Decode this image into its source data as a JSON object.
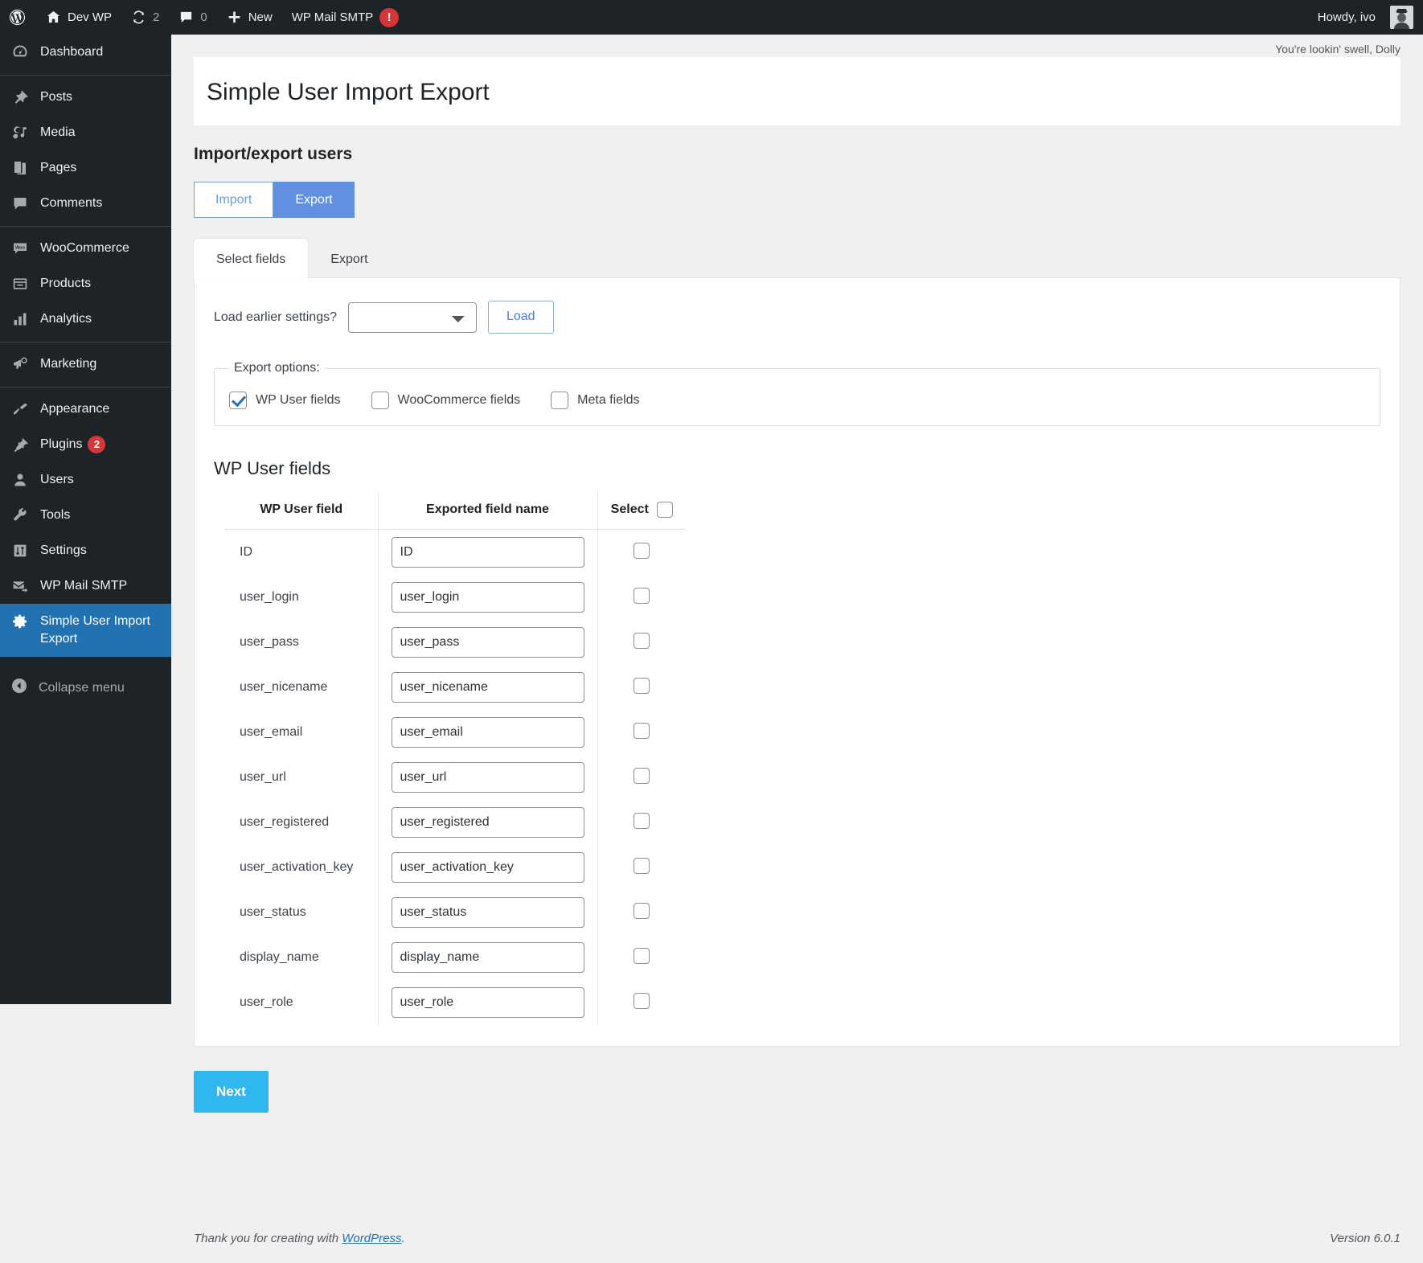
{
  "adminbar": {
    "wp_logo": "wordpress-logo-icon",
    "site_name": "Dev WP",
    "updates_count": "2",
    "comments_count": "0",
    "new_label": "New",
    "smtp_label": "WP Mail SMTP",
    "smtp_badge": "!",
    "howdy": "Howdy, ivo"
  },
  "sidebar": {
    "items": [
      {
        "label": "Dashboard",
        "icon": "dashboard-icon"
      },
      {
        "label": "Posts",
        "icon": "pin-icon"
      },
      {
        "label": "Media",
        "icon": "media-icon"
      },
      {
        "label": "Pages",
        "icon": "pages-icon"
      },
      {
        "label": "Comments",
        "icon": "comment-icon"
      },
      {
        "label": "WooCommerce",
        "icon": "woo-icon"
      },
      {
        "label": "Products",
        "icon": "product-icon"
      },
      {
        "label": "Analytics",
        "icon": "analytics-icon"
      },
      {
        "label": "Marketing",
        "icon": "megaphone-icon"
      },
      {
        "label": "Appearance",
        "icon": "paintbrush-icon"
      },
      {
        "label": "Plugins",
        "icon": "plug-icon",
        "count": "2"
      },
      {
        "label": "Users",
        "icon": "user-icon"
      },
      {
        "label": "Tools",
        "icon": "wrench-icon"
      },
      {
        "label": "Settings",
        "icon": "sliders-icon"
      },
      {
        "label": "WP Mail SMTP",
        "icon": "mail-arrow-icon"
      },
      {
        "label": "Simple User Import Export",
        "icon": "gear-icon",
        "current": true
      }
    ],
    "collapse_label": "Collapse menu"
  },
  "screen_meta": "You're lookin' swell, Dolly",
  "page": {
    "title": "Simple User Import Export",
    "section_title": "Import/export users"
  },
  "mode_tabs": {
    "import_label": "Import",
    "export_label": "Export",
    "active": "Export"
  },
  "inner_tabs": [
    {
      "label": "Select fields",
      "active": true
    },
    {
      "label": "Export",
      "active": false
    }
  ],
  "load_settings": {
    "label": "Load earlier settings?",
    "selected_value": "",
    "button_label": "Load"
  },
  "export_options": {
    "legend": "Export options:",
    "options": [
      {
        "label": "WP User fields",
        "checked": true
      },
      {
        "label": "WooCommerce fields",
        "checked": false
      },
      {
        "label": "Meta fields",
        "checked": false
      }
    ]
  },
  "fields_section": {
    "heading": "WP User fields",
    "columns": {
      "field": "WP User field",
      "exported": "Exported field name",
      "select": "Select"
    },
    "select_all_checked": false,
    "rows": [
      {
        "field": "ID",
        "exported": "ID",
        "selected": false
      },
      {
        "field": "user_login",
        "exported": "user_login",
        "selected": false
      },
      {
        "field": "user_pass",
        "exported": "user_pass",
        "selected": false
      },
      {
        "field": "user_nicename",
        "exported": "user_nicename",
        "selected": false
      },
      {
        "field": "user_email",
        "exported": "user_email",
        "selected": false
      },
      {
        "field": "user_url",
        "exported": "user_url",
        "selected": false
      },
      {
        "field": "user_registered",
        "exported": "user_registered",
        "selected": false
      },
      {
        "field": "user_activation_key",
        "exported": "user_activation_key",
        "selected": false
      },
      {
        "field": "user_status",
        "exported": "user_status",
        "selected": false
      },
      {
        "field": "display_name",
        "exported": "display_name",
        "selected": false
      },
      {
        "field": "user_role",
        "exported": "user_role",
        "selected": false
      }
    ]
  },
  "next_button": "Next",
  "footer": {
    "thanks_prefix": "Thank you for creating with ",
    "wordpress_link": "WordPress",
    "thanks_suffix": ".",
    "version": "Version 6.0.1"
  },
  "colors": {
    "adminbar_bg": "#1d2327",
    "sidebar_bg": "#1d2327",
    "current_menu": "#2271b1",
    "export_btn": "#6290e0",
    "next_btn": "#2fb8f0",
    "badge_red": "#d63638"
  }
}
